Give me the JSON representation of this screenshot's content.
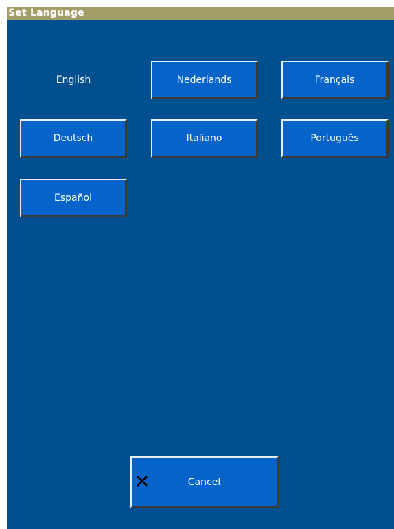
{
  "window": {
    "title": "Set Language"
  },
  "languages": {
    "current": "English",
    "options": [
      {
        "label": "English"
      },
      {
        "label": "Nederlands"
      },
      {
        "label": "Français"
      },
      {
        "label": "Deutsch"
      },
      {
        "label": "Italiano"
      },
      {
        "label": "Português"
      },
      {
        "label": "Español"
      }
    ]
  },
  "cancel": {
    "label": "Cancel",
    "icon": "close-icon"
  },
  "colors": {
    "title_bar": "#a49d68",
    "background": "#024f8f",
    "button": "#0563c9",
    "text": "#ffffff"
  }
}
